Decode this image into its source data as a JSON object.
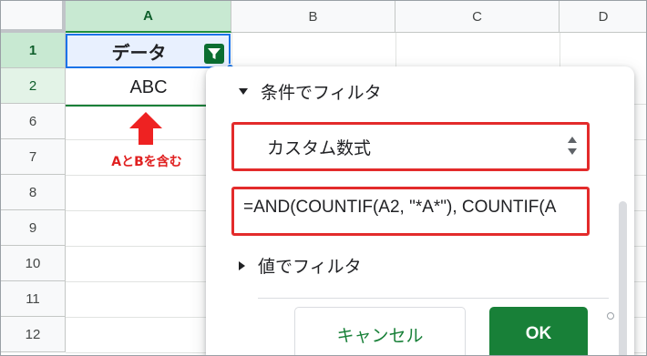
{
  "columns": [
    "A",
    "B",
    "C",
    "D"
  ],
  "rows": [
    "1",
    "2",
    "6",
    "7",
    "8",
    "9",
    "10",
    "11",
    "12"
  ],
  "cells": {
    "a1": "データ",
    "a2": "ABC"
  },
  "annotation": {
    "text": "AとBを含む",
    "color": "#e02020"
  },
  "filter_menu": {
    "condition_header": "条件でフィルタ",
    "condition_select_value": "カスタム数式",
    "formula_value": "=AND(COUNTIF(A2, \"*A*\"), COUNTIF(A",
    "value_header": "値でフィルタ",
    "cancel_label": "キャンセル",
    "ok_label": "OK"
  },
  "colors": {
    "accent_green": "#188038",
    "selection_blue": "#1a73e8",
    "highlight_red": "#e32b2b"
  },
  "icons": [
    "filter-icon",
    "up-arrow-icon",
    "caret-down-icon",
    "caret-right-icon",
    "select-updown-icon"
  ]
}
